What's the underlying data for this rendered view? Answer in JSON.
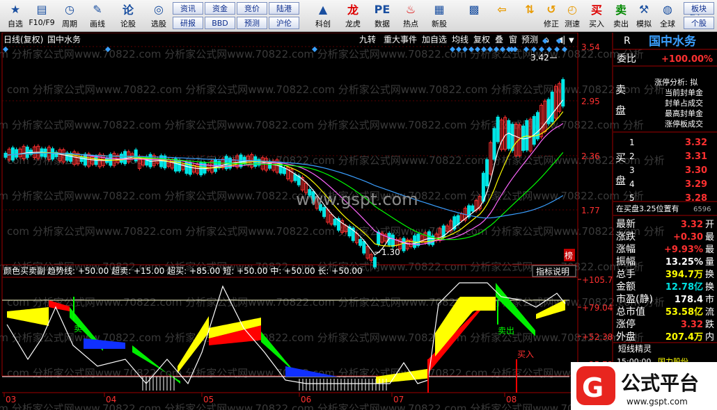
{
  "toolbar": {
    "left": [
      {
        "label": "自选",
        "icon": "star-icon"
      },
      {
        "label": "F10/F9",
        "icon": "f10-icon"
      },
      {
        "label": "周期",
        "icon": "period-clock-icon"
      },
      {
        "label": "画线",
        "icon": "pencil-icon"
      },
      {
        "label": "论股",
        "icon": "forum-icon"
      },
      {
        "label": "选股",
        "icon": "target-icon"
      }
    ],
    "mid_top": [
      "资讯",
      "资金",
      "竞价",
      "陆港"
    ],
    "mid_bottom": [
      "研报",
      "BBD",
      "预测",
      "沪伦"
    ],
    "right": [
      {
        "label": "科创",
        "icon": "chart-icon"
      },
      {
        "label": "龙虎",
        "icon": "dragon-icon"
      },
      {
        "label": "数据",
        "icon": "pe-icon"
      },
      {
        "label": "热点",
        "icon": "fire-icon"
      },
      {
        "label": "新股",
        "icon": "new-stock-icon"
      },
      {
        "label": "",
        "icon": "color-grid-icon"
      },
      {
        "label": "",
        "icon": "back-arrow-icon"
      },
      {
        "label": "",
        "icon": "up-down-arrow-icon"
      },
      {
        "label": "修正",
        "icon": "fix-icon"
      },
      {
        "label": "测速",
        "icon": "speed-icon"
      },
      {
        "label": "买入",
        "icon": "buy-icon"
      },
      {
        "label": "卖出",
        "icon": "sell-icon"
      },
      {
        "label": "模拟",
        "icon": "hammer-icon"
      },
      {
        "label": "全球",
        "icon": "globe-icon"
      },
      {
        "label": "板块",
        "icon": "sector-icon"
      },
      {
        "label": "个股",
        "icon": "stock-icon"
      }
    ],
    "buy_glyph": "买",
    "sell_glyph": "卖",
    "sector_top": "板块"
  },
  "chart": {
    "title": "日线(复权)",
    "stock": "国中水务",
    "menu": [
      "九转",
      "重大事件",
      "加自选",
      "均线",
      "复权",
      "叠",
      "窗",
      "预测"
    ],
    "axis_main": [
      "3.54",
      "2.95",
      "2.36",
      "1.77"
    ],
    "high_label": "3.42",
    "low_label": "1.30",
    "badge": "榜",
    "indicator_title": "颜色买卖副",
    "indicator_params": "趋势线: +50.00 超卖: +15.00 超买: +85.00 短: +50.00 中: +50.00 长: +50.00",
    "indicator_button": "指标说明",
    "axis_ind": [
      "+105.7",
      "+79.04",
      "+52.38",
      "+25.72"
    ],
    "sell_label": "卖",
    "sell_label2": "卖出",
    "buy_label": "买入",
    "months": [
      "03",
      "04",
      "05",
      "06",
      "07",
      "08"
    ],
    "watermark": "www.gspt.com",
    "bg_text": "com 分析家公式网www.70822.com 分析家公式网www.70822.com 分析家公式网www.70822.com 分析家公式网www.70822.com 分析"
  },
  "panel": {
    "header_letter": "R",
    "stock": "国中水务",
    "weibi_label": "委比",
    "weibi_value": "+100.00%",
    "sell_label": "卖盘",
    "buy_label": "买盘",
    "limit_lines": [
      "涨停分析: 拟",
      "当前封单金",
      "封单占成交",
      "最高封单金",
      "涨停板成交"
    ],
    "buy_rows": [
      {
        "n": "1",
        "p": "3.32"
      },
      {
        "n": "2",
        "p": "3.31"
      },
      {
        "n": "3",
        "p": "3.30"
      },
      {
        "n": "4",
        "p": "3.29"
      },
      {
        "n": "5",
        "p": "3.28"
      }
    ],
    "position_text": "在买盘3.25位置有",
    "position_num": "6596",
    "stats": [
      {
        "k": "最新",
        "v": "3.32",
        "s": "开",
        "c": "red"
      },
      {
        "k": "涨跌",
        "v": "+0.30",
        "s": "最",
        "c": "red"
      },
      {
        "k": "涨幅",
        "v": "+9.93%",
        "s": "最",
        "c": "red"
      },
      {
        "k": "振幅",
        "v": "13.25%",
        "s": "量",
        "c": "wht"
      },
      {
        "k": "总手",
        "v": "394.7万",
        "s": "换",
        "c": "yel"
      },
      {
        "k": "金额",
        "v": "12.78亿",
        "s": "换",
        "c": "cyan"
      },
      {
        "k": "市盈(静)",
        "v": "178.4",
        "s": "市",
        "c": "wht"
      },
      {
        "k": "总市值",
        "v": "53.58亿",
        "s": "流",
        "c": "yel"
      },
      {
        "k": "涨停",
        "v": "3.32",
        "s": "跌",
        "c": "red"
      },
      {
        "k": "外盘",
        "v": "207.4万",
        "s": "内",
        "c": "yel"
      }
    ],
    "sprite_title": "短线精灵",
    "sprite_row": {
      "time": "15:00:00",
      "name": "国力股份"
    }
  },
  "logo": {
    "text": "公式平台",
    "url": "www.gspt.com"
  }
}
